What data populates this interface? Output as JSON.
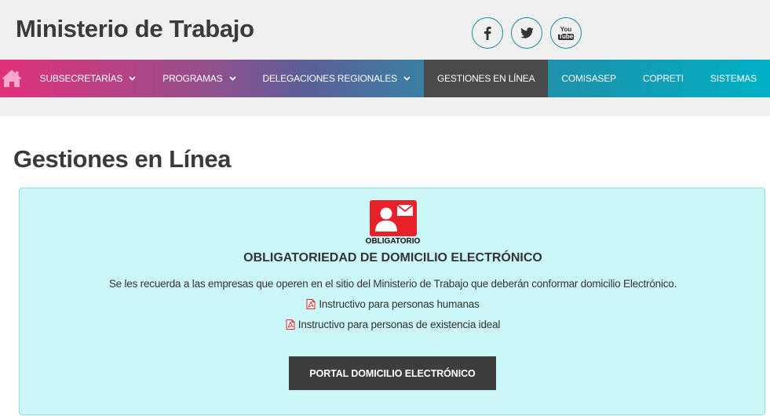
{
  "header": {
    "title": "Ministerio de Trabajo",
    "social": [
      {
        "name": "facebook",
        "icon": "facebook-icon"
      },
      {
        "name": "twitter",
        "icon": "twitter-icon"
      },
      {
        "name": "youtube",
        "icon": "youtube-icon",
        "label_top": "You",
        "label_bottom": "Tube"
      }
    ]
  },
  "nav": {
    "home_icon": "home-icon",
    "items": [
      {
        "label": "SUBSECRETARÍAS",
        "dropdown": true
      },
      {
        "label": "PROGRAMAS",
        "dropdown": true
      },
      {
        "label": "DELEGACIONES REGIONALES",
        "dropdown": true
      },
      {
        "label": "GESTIONES EN LÍNEA",
        "dropdown": false,
        "active": true
      },
      {
        "label": "COMISASEP",
        "dropdown": false
      },
      {
        "label": "COPRETI",
        "dropdown": false
      },
      {
        "label": "SISTEMAS",
        "dropdown": false
      }
    ]
  },
  "page": {
    "title": "Gestiones en Línea"
  },
  "panel": {
    "badge_caption": "OBLIGATORIO",
    "title": "OBLIGATORIEDAD DE DOMICILIO ELECTRÓNICO",
    "description": "Se les recuerda a las empresas que operen en el sitio del Ministerio de Trabajo que deberán conformar domicilio Electrónico.",
    "links": [
      {
        "label": "Instructivo para personas humanas",
        "icon": "pdf-icon"
      },
      {
        "label": "Instructivo para personas de existencia ideal",
        "icon": "pdf-icon"
      }
    ],
    "button_label": "PORTAL DOMICILIO ELECTRÓNICO"
  },
  "colors": {
    "accent_teal": "#1e8aa0",
    "panel_bg": "#ccf7f8",
    "badge_red": "#e8202a",
    "button_dark": "#3d3d3d",
    "nav_active": "#4a4a4a"
  }
}
